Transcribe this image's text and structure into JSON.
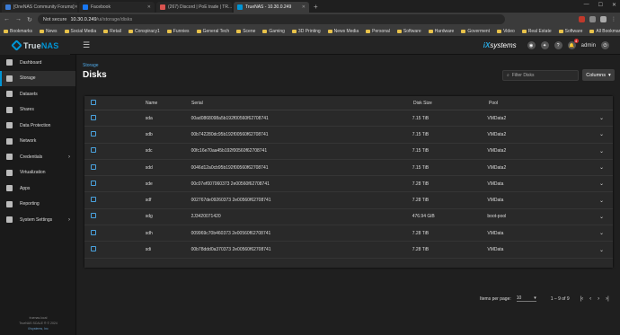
{
  "browser": {
    "tabs": [
      {
        "label": "[OneNAS Community Forums]",
        "color": "#3a7bd5"
      },
      {
        "label": "Facebook",
        "color": "#1877f2"
      },
      {
        "label": "(267) Discord | PoE trade | TR...",
        "color": "#d9534f"
      },
      {
        "label": "TrueNAS - 10.30.0.249",
        "color": "#0095d5",
        "active": true
      }
    ],
    "new_tab": "+",
    "url_security": "Not secure",
    "url_host": "10.30.0.249",
    "url_path": "/ui/storage/disks",
    "bookmarks": [
      "Bookmarks",
      "News",
      "Social Media",
      "Retail",
      "Conspiracy1",
      "Funnies",
      "General Tech",
      "Scene",
      "Gaming",
      "3D Printing",
      "News Media",
      "Personal",
      "Software",
      "Hardware",
      "Goverment",
      "Video",
      "Real Estate",
      "Software"
    ],
    "all_bookmarks": "All Bookmarks"
  },
  "header": {
    "logo_a": "True",
    "logo_b": "NAS",
    "ix_a": "iX",
    "ix_b": "systems",
    "user": "admin",
    "alert_count": "4"
  },
  "sidebar": {
    "items": [
      {
        "label": "Dashboard"
      },
      {
        "label": "Storage",
        "active": true
      },
      {
        "label": "Datasets"
      },
      {
        "label": "Shares"
      },
      {
        "label": "Data Protection"
      },
      {
        "label": "Network"
      },
      {
        "label": "Credentials",
        "chev": true
      },
      {
        "label": "Virtualization"
      },
      {
        "label": "Apps"
      },
      {
        "label": "Reporting"
      },
      {
        "label": "System Settings",
        "chev": true
      }
    ],
    "footer_host": "truenas.local",
    "footer_version": "TrueNAS SCALE ® © 2024",
    "footer_link": "iXsystems, Inc"
  },
  "main": {
    "breadcrumb": "Storage",
    "title": "Disks",
    "filter_placeholder": "Filter Disks",
    "columns_button": "Columns",
    "table": {
      "headers": {
        "name": "Name",
        "serial": "Serial",
        "size": "Disk Size",
        "pool": "Pool"
      },
      "rows": [
        {
          "name": "sda",
          "serial": "00ad0868098a5b192f00560f62708741",
          "size": "7.15 TiB",
          "pool": "VMData2"
        },
        {
          "name": "sdb",
          "serial": "00b742280dc95b192f00560f62708741",
          "size": "7.15 TiB",
          "pool": "VMData2"
        },
        {
          "name": "sdc",
          "serial": "00fc16e70aa45b192f00560f62708741",
          "size": "7.15 TiB",
          "pool": "VMData2"
        },
        {
          "name": "sdd",
          "serial": "0046d12a0cb95b192f00560f62708741",
          "size": "7.15 TiB",
          "pool": "VMData2"
        },
        {
          "name": "sde",
          "serial": "00c07ef007060373 2e00560f62708741",
          "size": "7.28 TiB",
          "pool": "VMData"
        },
        {
          "name": "sdf",
          "serial": "002767de09260373 2e00560f62708741",
          "size": "7.28 TiB",
          "pool": "VMData"
        },
        {
          "name": "sdg",
          "serial": "2J3420071420",
          "size": "476.94 GiB",
          "pool": "boot-pool"
        },
        {
          "name": "sdh",
          "serial": "009969c70b460373 2e00560f62708741",
          "size": "7.28 TiB",
          "pool": "VMData"
        },
        {
          "name": "sdi",
          "serial": "00b78ddd0a370373 2e00560f62708741",
          "size": "7.28 TiB",
          "pool": "VMData"
        }
      ]
    },
    "pager": {
      "items_label": "Items per page:",
      "items_value": "10",
      "range": "1 – 9 of 9"
    }
  }
}
